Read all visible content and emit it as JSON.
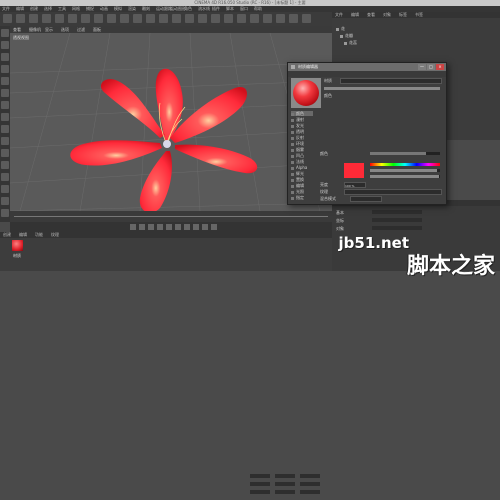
{
  "app": {
    "title": "CINEMA 4D R16.050 Studio (RC - R16) - [未标题 1] - 主要",
    "menu": [
      "文件",
      "编辑",
      "创建",
      "选择",
      "工具",
      "网格",
      "捕捉",
      "动画",
      "模拟",
      "渲染",
      "雕刻",
      "运动跟踪",
      "运动图形",
      "角色",
      "流水线",
      "插件",
      "脚本",
      "窗口",
      "帮助"
    ]
  },
  "viewport": {
    "menu": [
      "查看",
      "摄像机",
      "显示",
      "选项",
      "过滤",
      "面板"
    ],
    "label": "透视视图"
  },
  "object_manager": {
    "menu": [
      "文件",
      "编辑",
      "查看",
      "对象",
      "标签",
      "书签"
    ],
    "items": [
      "花",
      "花瓣",
      "花蕊"
    ]
  },
  "material_manager": {
    "menu": [
      "创建",
      "编辑",
      "功能",
      "纹理"
    ],
    "material_name": "材质"
  },
  "attribute_manager": {
    "tabs": [
      "模式",
      "编辑",
      "用户数据"
    ],
    "rows": [
      "基本",
      "坐标",
      "对象"
    ]
  },
  "material_editor": {
    "title": "材质编辑器",
    "controls": [
      "—",
      "□",
      "×"
    ],
    "name_label": "材质",
    "section": "颜色",
    "field_label_color": "颜色",
    "field_label_brightness": "亮度",
    "brightness_value": "100 %",
    "texture_label": "纹理",
    "mix_label": "混合模式",
    "mix_strength_label": "混合强度",
    "channels": [
      "颜色",
      "漫射",
      "发光",
      "透明",
      "反射",
      "环境",
      "烟雾",
      "凹凸",
      "法线",
      "Alpha",
      "辉光",
      "置换",
      "编辑",
      "光照",
      "指定"
    ],
    "active_channel": 0,
    "color_hex": "#ff2a37"
  },
  "watermark": {
    "logo": "脚本之家",
    "url": "jb51.net"
  },
  "colors": {
    "flower": "#ff3040",
    "ui_dark": "#3a3a3a"
  }
}
